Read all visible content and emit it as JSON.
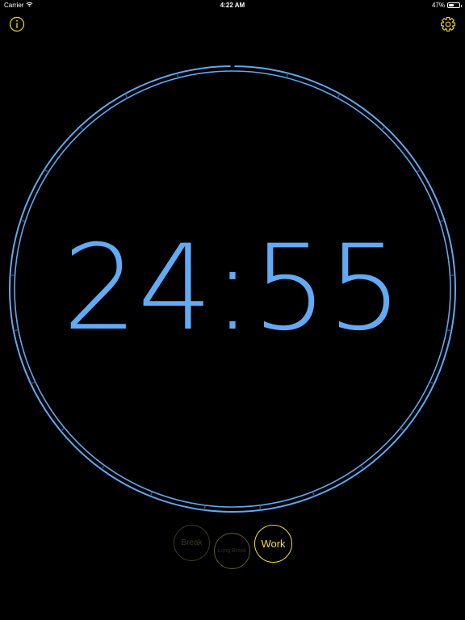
{
  "status_bar": {
    "carrier": "Carrier",
    "time": "4:22 AM",
    "battery_percent": "47%",
    "battery_level": 0.47,
    "wifi_icon": "wifi-icon",
    "battery_icon": "battery-icon"
  },
  "toolbar": {
    "info_icon": "info-icon",
    "settings_icon": "gear-icon"
  },
  "timer": {
    "display": "24:55",
    "progress": 0.0033
  },
  "modes": {
    "break_label": "Break",
    "middle_label": "Long Break",
    "work_label": "Work",
    "active": "Work"
  },
  "colors": {
    "background": "#000000",
    "timer_text": "#62abf4",
    "dial_ring": "#5fa9f0",
    "accent_yellow": "#f4de2c"
  }
}
